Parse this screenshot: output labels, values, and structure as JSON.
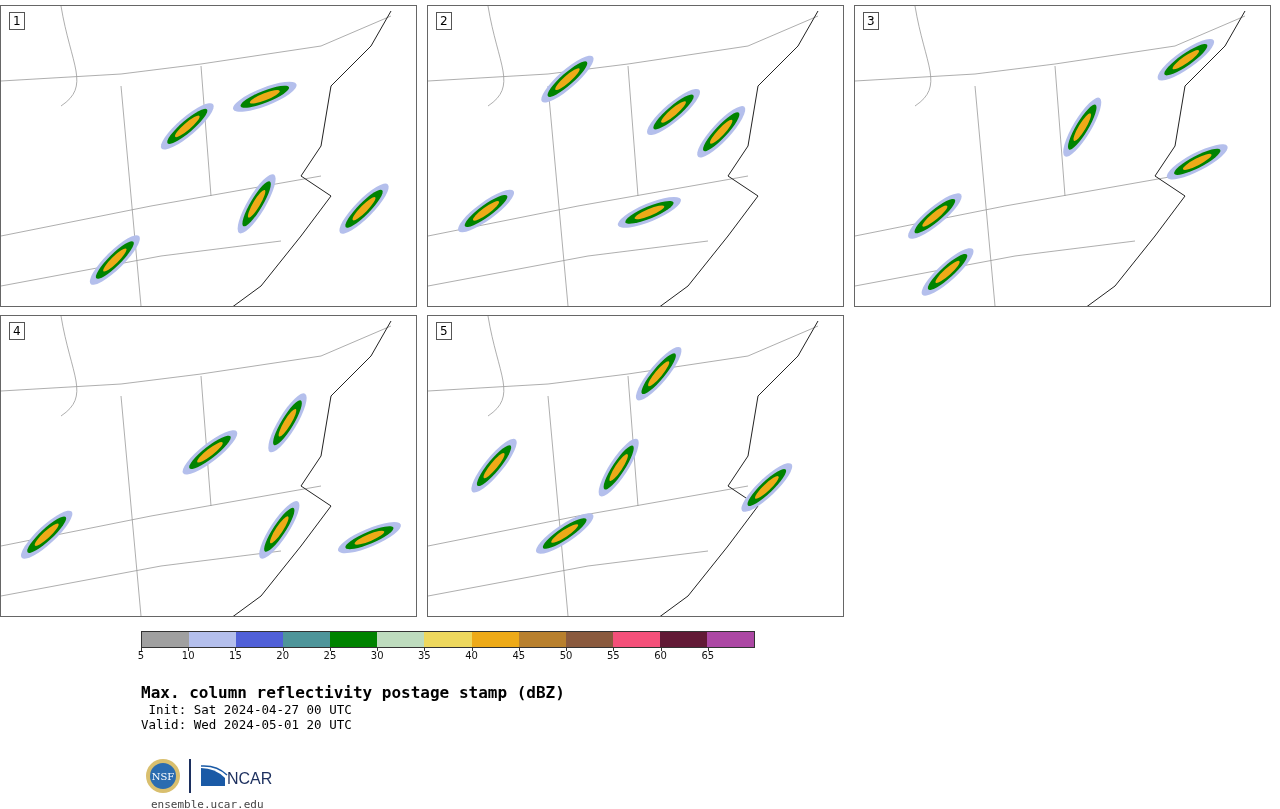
{
  "panels": [
    {
      "label": "1"
    },
    {
      "label": "2"
    },
    {
      "label": "3"
    },
    {
      "label": "4"
    },
    {
      "label": "5"
    }
  ],
  "colorbar": {
    "segments": [
      {
        "color": "#a0a0a0"
      },
      {
        "color": "#b4bfec"
      },
      {
        "color": "#5060d8"
      },
      {
        "color": "#4e959a"
      },
      {
        "color": "#008300"
      },
      {
        "color": "#bedcbe"
      },
      {
        "color": "#eed85e"
      },
      {
        "color": "#eeaa18"
      },
      {
        "color": "#b8802e"
      },
      {
        "color": "#8a5a3e"
      },
      {
        "color": "#f4507a"
      },
      {
        "color": "#621a36"
      },
      {
        "color": "#ac48a4"
      }
    ],
    "ticks": [
      "5",
      "10",
      "15",
      "20",
      "25",
      "30",
      "35",
      "40",
      "45",
      "50",
      "55",
      "60",
      "65"
    ]
  },
  "title": "Max. column reflectivity postage stamp (dBZ)",
  "init": " Init: Sat 2024-04-27 00 UTC",
  "valid": "Valid: Wed 2024-05-01 20 UTC",
  "logo": {
    "seal_text": "NSF",
    "wordmark": "NCAR"
  },
  "url": "ensemble.ucar.edu"
}
